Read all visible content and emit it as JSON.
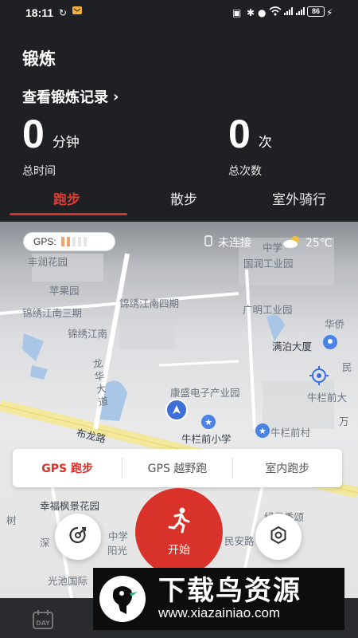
{
  "status_bar": {
    "time": "18:11",
    "battery": "86"
  },
  "header": {
    "title": "锻炼",
    "records_link": "查看锻炼记录",
    "records_chevron": "›"
  },
  "stats": {
    "time": {
      "value": "0",
      "unit": "分钟",
      "label": "总时间"
    },
    "count": {
      "value": "0",
      "unit": "次",
      "label": "总次数"
    }
  },
  "tabs": [
    {
      "label": "跑步",
      "active": true
    },
    {
      "label": "散步",
      "active": false
    },
    {
      "label": "室外骑行",
      "active": false
    }
  ],
  "map_overlay": {
    "gps_label": "GPS:",
    "gps_strength_bars": 2,
    "watch_status": "未连接",
    "temperature": "25℃"
  },
  "map_labels": {
    "l1": "丰润花园",
    "l2": "苹果园",
    "l3": "锦绣江南三期",
    "l4": "锦绣江南四期",
    "l5": "锦绣江南",
    "l6": "广明工业园",
    "l7": "满泊大厦",
    "l8": "华侨",
    "l9": "龙华大道",
    "l10": "康盛电子产业园",
    "l11": "布龙路",
    "l12": "牛栏前小学",
    "l13": "牛栏前村",
    "l14": "牛栏前大",
    "l15": "万",
    "l16": "民",
    "l17": "幸福枫景花园",
    "l18": "树",
    "l19": "深",
    "l20": "阳光",
    "l21": "光池国际",
    "l22": "民安路",
    "l23": "绿景香颂",
    "l24": "中学",
    "l25": "国润工业园",
    "l26": "中学"
  },
  "modes": [
    {
      "label": "GPS 跑步",
      "active": true
    },
    {
      "label": "GPS 越野跑",
      "active": false
    },
    {
      "label": "室内跑步",
      "active": false
    }
  ],
  "start_button": {
    "label": "开始"
  },
  "watermark": {
    "title": "下载鸟资源",
    "url": "www.xiazainiao.com"
  },
  "bottom_nav": {
    "day_label": "DAY"
  },
  "colors": {
    "accent": "#d8322b",
    "background": "#1f2023"
  }
}
